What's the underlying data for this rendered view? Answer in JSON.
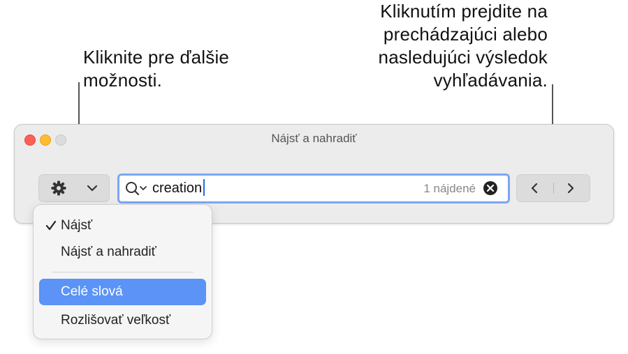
{
  "callouts": {
    "options": "Kliknite pre ďalšie\nmožnosti.",
    "navigation": "Kliknutím prejdite na\nprechádzajúci alebo\nnasledujúci výsledok\nvyhľadávania."
  },
  "window": {
    "title": "Nájsť a nahradiť"
  },
  "toolbar": {
    "options_button_icon": "gear-icon",
    "options_chevron_icon": "chevron-down-icon",
    "nav_prev_icon": "chevron-left-icon",
    "nav_next_icon": "chevron-right-icon"
  },
  "search": {
    "value": "creation",
    "match_count": "1 nájdené",
    "focus_color": "#7aa7f5"
  },
  "menu": {
    "items": [
      {
        "label": "Nájsť",
        "checked": true
      },
      {
        "label": "Nájsť a nahradiť",
        "checked": false
      },
      {
        "label": "Celé slová",
        "highlighted": true
      },
      {
        "label": "Rozlišovať veľkosť",
        "checked": false
      }
    ],
    "highlight_color": "#5b93f6"
  }
}
